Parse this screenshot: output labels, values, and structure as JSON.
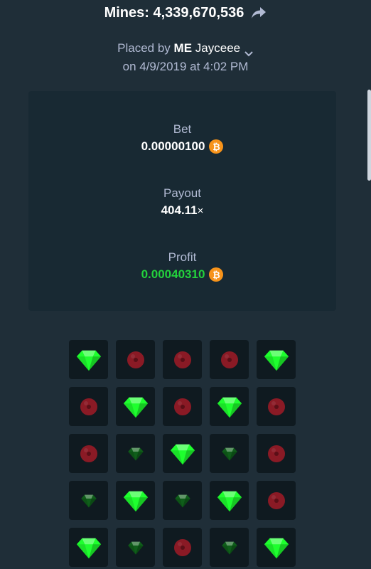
{
  "header": {
    "title": "Mines: 4,339,670,536",
    "share_icon": "share-arrow-icon"
  },
  "meta": {
    "placed_by_prefix": "Placed by",
    "rank": "ME",
    "username": "Jayceee",
    "date_line": "on 4/9/2019 at 4:02 PM"
  },
  "stats": {
    "bet_label": "Bet",
    "bet_value": "0.00000100",
    "payout_label": "Payout",
    "payout_value": "404.11",
    "payout_suffix": "×",
    "profit_label": "Profit",
    "profit_value": "0.00040310",
    "currency_icon": "bitcoin-icon",
    "currency_symbol": "₿"
  },
  "colors": {
    "background": "#1f2e38",
    "panel": "#182933",
    "profit": "#23d13c",
    "gem": "#1eff2e",
    "gem_dim": "#0f5e1a",
    "mine": "#8a1a25",
    "bitcoin": "#f7931a"
  },
  "board": {
    "rows": [
      [
        "gem",
        "mine",
        "mine",
        "mine",
        "gem"
      ],
      [
        "mine",
        "gem",
        "mine",
        "gem",
        "mine"
      ],
      [
        "mine",
        "gem-dim",
        "gem",
        "gem-dim",
        "mine"
      ],
      [
        "gem-dim",
        "gem",
        "gem-dim",
        "gem",
        "mine"
      ],
      [
        "gem",
        "gem-dim",
        "mine",
        "gem-dim",
        "gem"
      ]
    ]
  }
}
